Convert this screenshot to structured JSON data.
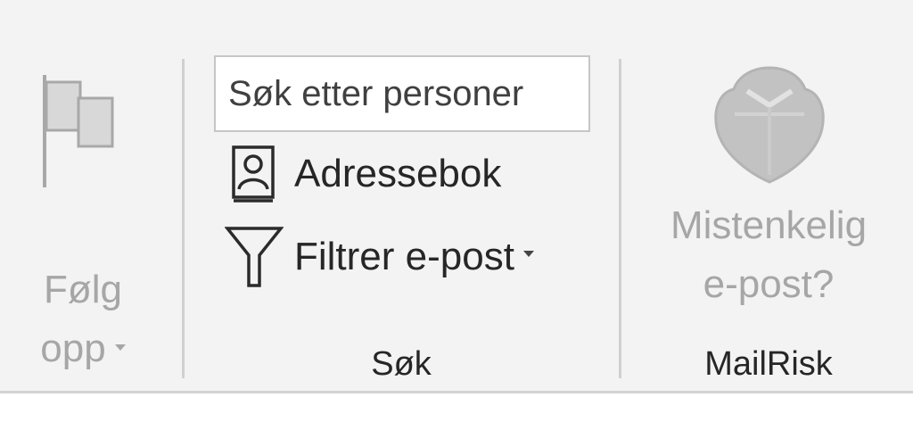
{
  "ribbon": {
    "follow_up": {
      "label_line1": "Følg",
      "label_line2": "opp",
      "enabled": false
    },
    "search_group": {
      "search_input": {
        "value": "",
        "placeholder": "Søk etter personer"
      },
      "address_book_label": "Adressebok",
      "filter_email_label": "Filtrer e-post",
      "group_label": "Søk"
    },
    "mailrisk_group": {
      "button_line1": "Mistenkelig",
      "button_line2": "e-post?",
      "enabled": false,
      "group_label": "MailRisk"
    }
  },
  "icons": {
    "follow_up": "flag-icon",
    "address_book": "address-book-icon",
    "filter": "filter-funnel-icon",
    "mailrisk": "shield-heart-icon"
  },
  "colors": {
    "ribbon_bg": "#f3f3f3",
    "text": "#262626",
    "disabled_text": "#a6a6a6",
    "separator": "#d0d0d0"
  }
}
